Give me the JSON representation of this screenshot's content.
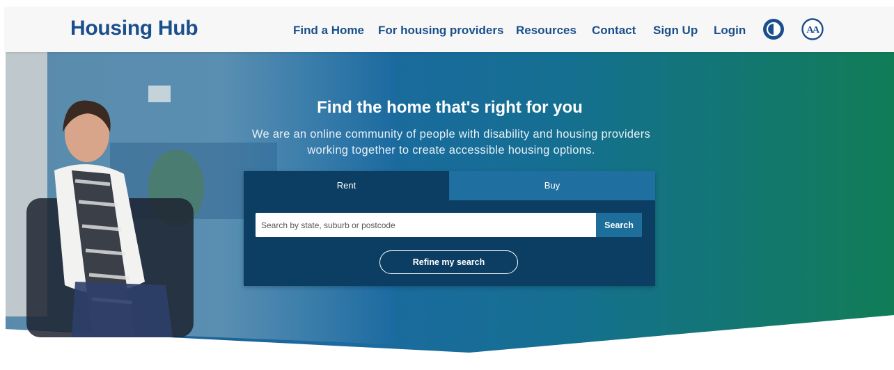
{
  "header": {
    "logo": "Housing Hub",
    "nav": [
      {
        "label": "Find a Home"
      },
      {
        "label": "For housing providers"
      },
      {
        "label": "Resources"
      },
      {
        "label": "Contact"
      },
      {
        "label": "Sign Up"
      },
      {
        "label": "Login"
      }
    ],
    "icons": {
      "contrast": "contrast-toggle-icon",
      "text_size": "text-size-icon"
    },
    "text_size_glyph": "AA"
  },
  "hero": {
    "title": "Find the home that's right for you",
    "subtitle_line1": "We are an online community of people with disability and housing providers",
    "subtitle_line2": "working together to create accessible housing options.",
    "photo": "woman-in-wheelchair-photo"
  },
  "search": {
    "tabs": [
      {
        "label": "Rent"
      },
      {
        "label": "Buy"
      }
    ],
    "active_tab": "Rent",
    "placeholder": "Search by state, suburb or postcode",
    "value": "",
    "button_label": "Search",
    "refine_label": "Refine my search"
  },
  "colors": {
    "brand": "#1a4f8b",
    "header_bg": "#f7f7f7",
    "card_bg": "#0c3e63",
    "tab_inactive": "#1f6fa0",
    "gradient_blue": "#1d6a9f",
    "gradient_green": "#117d57"
  }
}
